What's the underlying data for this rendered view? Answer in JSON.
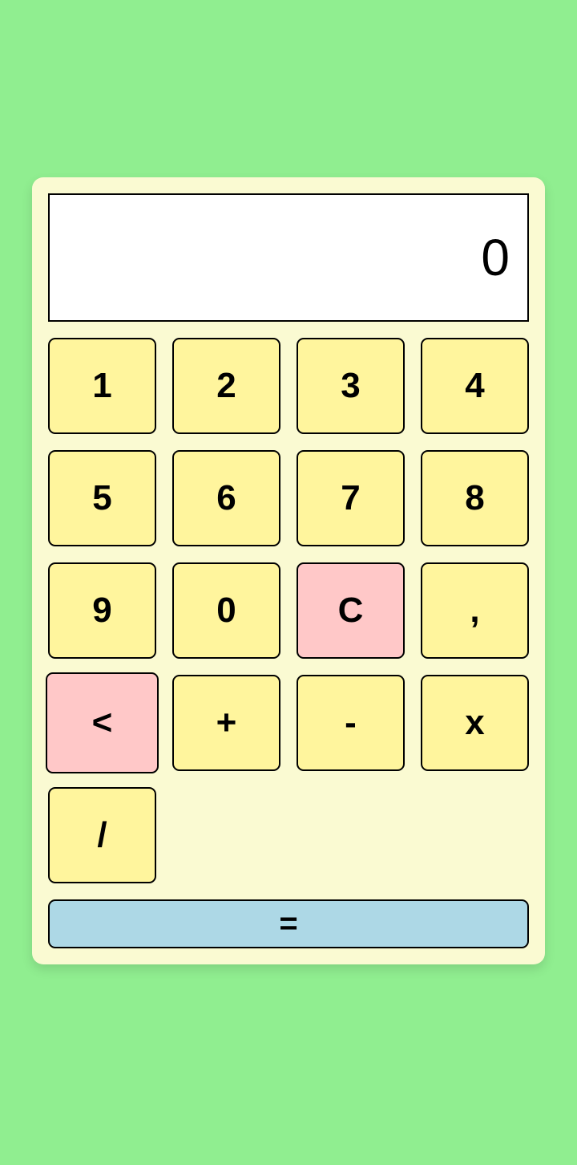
{
  "display": {
    "value": "0"
  },
  "keys": {
    "k1": "1",
    "k2": "2",
    "k3": "3",
    "k4": "4",
    "k5": "5",
    "k6": "6",
    "k7": "7",
    "k8": "8",
    "k9": "9",
    "k0": "0",
    "clear": "C",
    "comma": ",",
    "backspace": "<",
    "plus": "+",
    "minus": "-",
    "multiply": "x",
    "divide": "/"
  },
  "equals": {
    "label": "="
  },
  "colors": {
    "background": "#90ee90",
    "panel": "#fafad2",
    "key": "#fff59d",
    "key_danger": "#ffc8c8",
    "equals": "#add8e6",
    "display": "#ffffff"
  }
}
